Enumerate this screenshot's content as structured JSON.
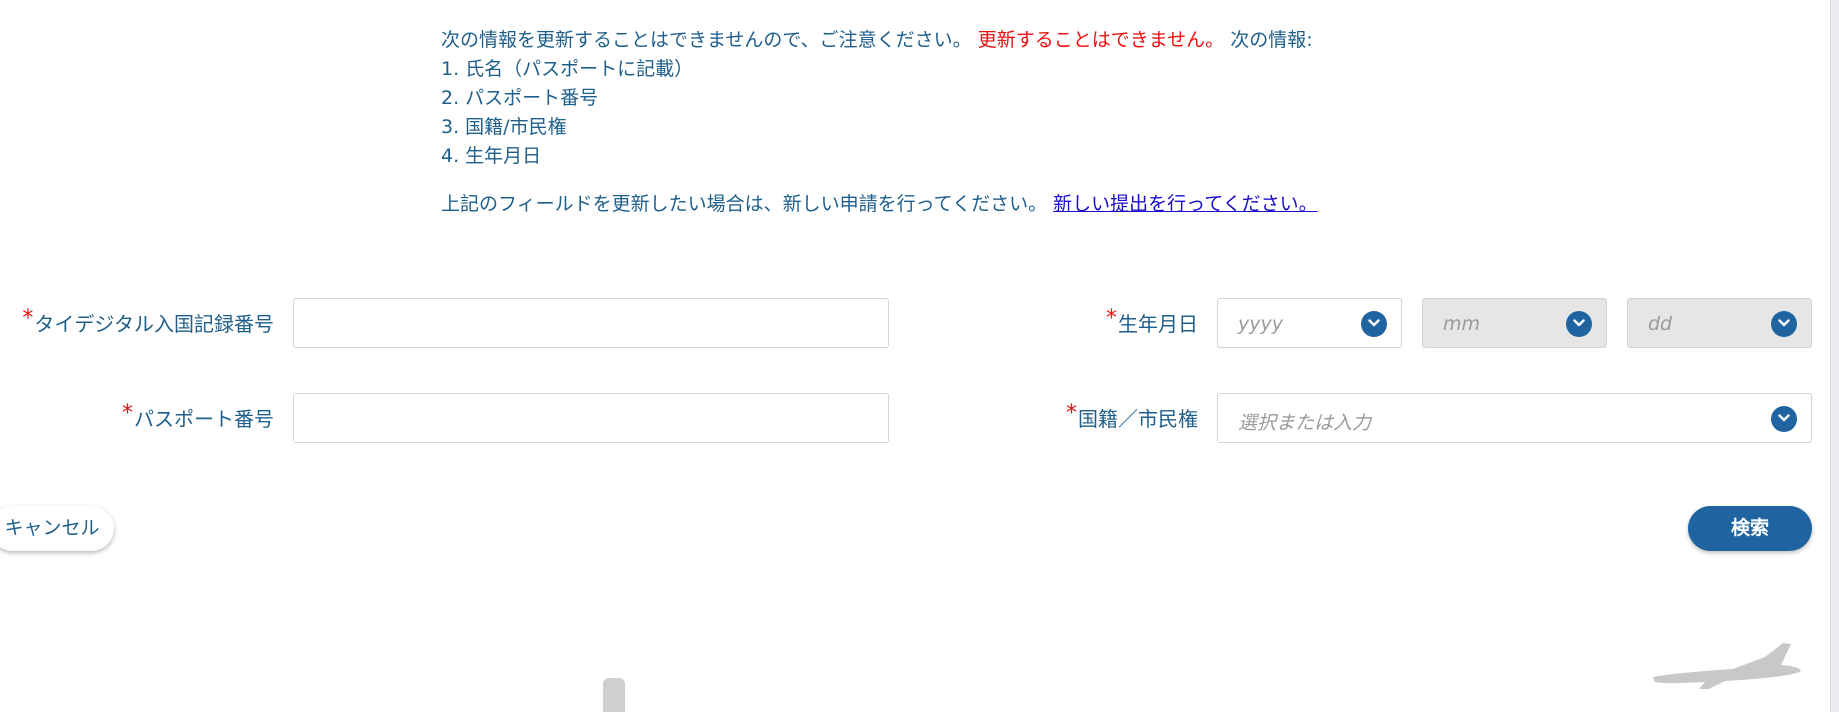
{
  "notice": {
    "line1_prefix": "次の情報を更新することはできませんので、ご注意ください。",
    "line1_red": "更新することはできません。",
    "line1_suffix": "次の情報:",
    "items": [
      "1. 氏名（パスポートに記載）",
      "2. パスポート番号",
      "3. 国籍/市民権",
      "4. 生年月日"
    ],
    "resubmit_text": "上記のフィールドを更新したい場合は、新しい申請を行ってください。",
    "resubmit_link": "新しい提出を行ってください。"
  },
  "form": {
    "required_mark": "*",
    "tdac_label": "タイデジタル入国記録番号",
    "tdac_value": "",
    "passport_label": "パスポート番号",
    "passport_value": "",
    "dob_label": "生年月日",
    "dob_year_placeholder": "yyyy",
    "dob_month_placeholder": "mm",
    "dob_day_placeholder": "dd",
    "nationality_label": "国籍／市民権",
    "nationality_placeholder": "選択または入力"
  },
  "buttons": {
    "cancel": "キャンセル",
    "search": "検索"
  },
  "colors": {
    "text": "#1f5f8b",
    "required": "#ee1111",
    "link": "#1a0dcc",
    "primary": "#1f64a0",
    "disabled_bg": "#e6e6e6"
  },
  "icons": {
    "dropdown": "chevron-down-icon",
    "decoration": "airplane-icon"
  }
}
